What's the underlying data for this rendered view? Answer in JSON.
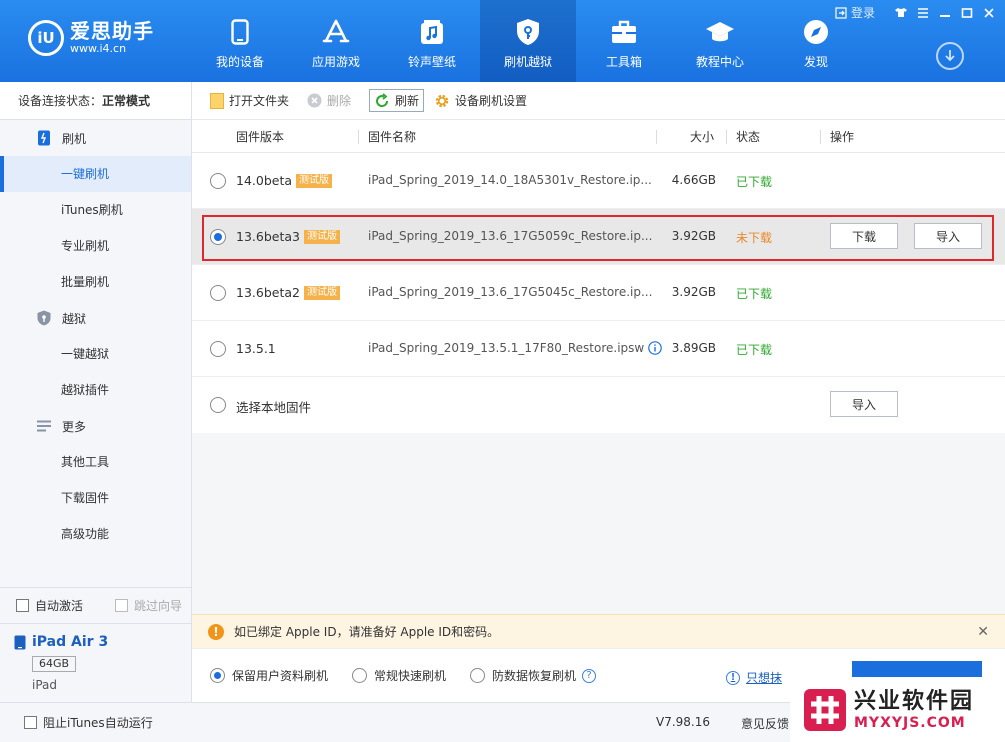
{
  "app": {
    "logo_mark": "iU",
    "name": "爱思助手",
    "url": "www.i4.cn"
  },
  "window": {
    "login": "登录"
  },
  "nav": [
    {
      "label": "我的设备",
      "icon": "phone-icon"
    },
    {
      "label": "应用游戏",
      "icon": "app-store-icon"
    },
    {
      "label": "铃声壁纸",
      "icon": "music-icon"
    },
    {
      "label": "刷机越狱",
      "icon": "shield-key-icon"
    },
    {
      "label": "工具箱",
      "icon": "toolbox-icon"
    },
    {
      "label": "教程中心",
      "icon": "graduation-cap-icon"
    },
    {
      "label": "发现",
      "icon": "compass-icon"
    }
  ],
  "sidebar": {
    "conn_label": "设备连接状态：",
    "conn_value": "正常模式",
    "flash_group": "刷机",
    "flash_items": [
      "一键刷机",
      "iTunes刷机",
      "专业刷机",
      "批量刷机"
    ],
    "jb_group": "越狱",
    "jb_items": [
      "一键越狱",
      "越狱插件"
    ],
    "more_group": "更多",
    "more_items": [
      "其他工具",
      "下载固件",
      "高级功能"
    ],
    "auto_activate": "自动激活",
    "skip_guide": "跳过向导",
    "device_name": "iPad Air 3",
    "device_capacity": "64GB",
    "device_type": "iPad"
  },
  "toolbar": {
    "open_folder": "打开文件夹",
    "delete": "删除",
    "refresh": "刷新",
    "settings": "设备刷机设置"
  },
  "table": {
    "headers": [
      "固件版本",
      "固件名称",
      "大小",
      "状态",
      "操作"
    ],
    "rows": [
      {
        "version": "14.0beta",
        "tag": "测试版",
        "name": "iPad_Spring_2019_14.0_18A5301v_Restore.ip...",
        "size": "4.66GB",
        "status": "已下载"
      },
      {
        "version": "13.6beta3",
        "tag": "测试版",
        "name": "iPad_Spring_2019_13.6_17G5059c_Restore.ip...",
        "size": "3.92GB",
        "status": "未下载",
        "btn_download": "下载",
        "btn_import": "导入"
      },
      {
        "version": "13.6beta2",
        "tag": "测试版",
        "name": "iPad_Spring_2019_13.6_17G5045c_Restore.ip...",
        "size": "3.92GB",
        "status": "已下载"
      },
      {
        "version": "13.5.1",
        "name": "iPad_Spring_2019_13.5.1_17F80_Restore.ipsw",
        "size": "3.89GB",
        "status": "已下载"
      }
    ],
    "local_label": "选择本地固件",
    "local_import": "导入"
  },
  "notice": {
    "text": "如已绑定 Apple ID，请准备好 Apple ID和密码。"
  },
  "modes": {
    "keep_data": "保留用户资料刷机",
    "quick": "常规快速刷机",
    "anti_recovery": "防数据恢复刷机",
    "flash_only": "只想抹"
  },
  "statusbar": {
    "block_itunes": "阻止iTunes自动运行",
    "version": "V7.98.16",
    "feedback": "意见反馈"
  },
  "watermark": {
    "title": "兴业软件园",
    "url": "MYXYJS.COM"
  },
  "colors": {
    "header_blue": "#1a72e0",
    "accent": "#1b6fdc",
    "downloaded": "#2fa82f",
    "not_downloaded": "#e8892b",
    "tag": "#f6b24a",
    "highlight_red": "#e0282c"
  }
}
